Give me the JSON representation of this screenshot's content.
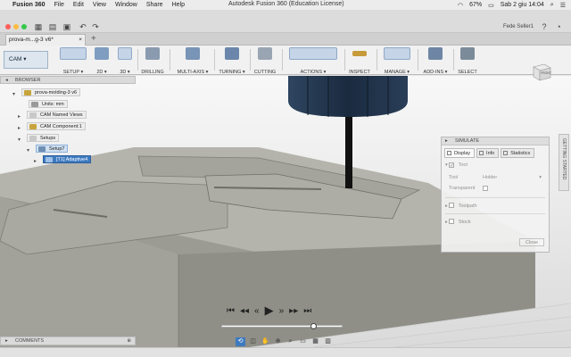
{
  "menubar": {
    "app_name": "Fusion 360",
    "items": [
      "File",
      "Edit",
      "View",
      "Window",
      "Share",
      "Help"
    ],
    "window_title": "Autodesk Fusion 360 (Education License)",
    "battery": "67%",
    "clock": "Sab 2 giu  14:04"
  },
  "qat": {
    "user": "Fede Seller1"
  },
  "tab": {
    "label": "prova-m...g-3 v6*",
    "close": "×",
    "add": "+"
  },
  "ribbon": {
    "workspace": "CAM ▾",
    "groups": [
      {
        "label": "SETUP ▾",
        "color": "#6f8fb5"
      },
      {
        "label": "2D ▾",
        "color": "#7f9dc0"
      },
      {
        "label": "3D ▾",
        "color": "#5f83ad"
      },
      {
        "label": "DRILLING",
        "color": "#8a9bb0"
      },
      {
        "label": "MULTI-AXIS ▾",
        "color": "#7894b6"
      },
      {
        "label": "TURNING ▾",
        "color": "#6a87ab"
      },
      {
        "label": "CUTTING",
        "color": "#9aa5b3"
      },
      {
        "label": "ACTIONS ▾",
        "color": "#4f7fb7"
      },
      {
        "label": "INSPECT",
        "color": "#c79a3a"
      },
      {
        "label": "MANAGE ▾",
        "color": "#7d8e9f"
      },
      {
        "label": "ADD-INS ▾",
        "color": "#6e86a4"
      },
      {
        "label": "SELECT",
        "color": "#7b8b99"
      }
    ]
  },
  "browser": {
    "title": "BROWSER",
    "nodes": [
      "prova-molding-3 v6",
      "Units: mm",
      "CAM Named Views",
      "CAM Component:1",
      "Setups",
      "Setup7",
      "[T1] Adaptive4"
    ]
  },
  "simulate": {
    "title": "SIMULATE",
    "tabs": [
      "Display",
      "Info",
      "Statistics"
    ],
    "tool_label": "Tool",
    "tool_field_label": "Tool",
    "tool_field_value": "Holder",
    "transparent_label": "Transparent",
    "toolpath_label": "Toolpath",
    "stock_label": "Stock",
    "close_label": "Close"
  },
  "side_tab": "GETTING STARTED",
  "comments": {
    "title": "COMMENTS"
  },
  "viewcube": {
    "face_label": "FRONT"
  },
  "playback": {
    "progress": 0.78
  },
  "colors": {
    "stock": "#a7a7a0",
    "stock_dark": "#8d8d86",
    "cutter": "#1e2f43",
    "accent": "#3e7ac0"
  }
}
